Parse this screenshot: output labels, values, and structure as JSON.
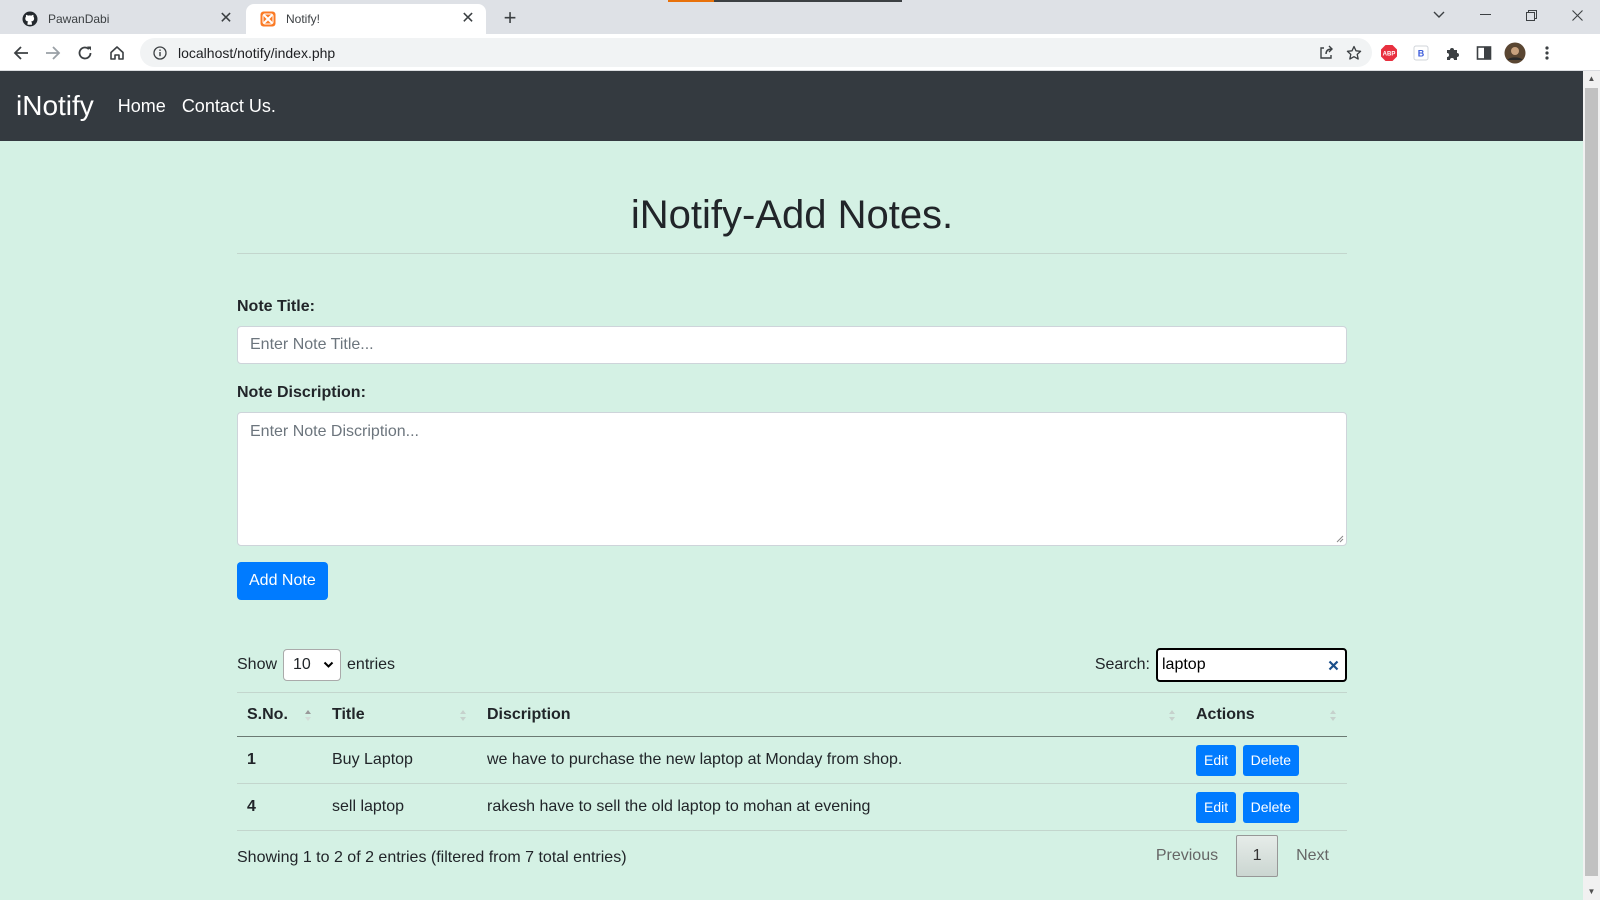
{
  "browser": {
    "tabs": [
      {
        "title": "PawanDabi",
        "icon": "github-icon"
      },
      {
        "title": "Notify!",
        "icon": "xampp-icon"
      }
    ],
    "url": "localhost/notify/index.php",
    "extensions": [
      "adblock-icon",
      "b-extension-icon",
      "puzzle-icon",
      "sidebar-icon",
      "profile-avatar",
      "menu-icon"
    ]
  },
  "navbar": {
    "brand": "iNotify",
    "links": [
      "Home",
      "Contact Us."
    ]
  },
  "form": {
    "heading": "iNotify-Add Notes.",
    "title_label": "Note Title:",
    "title_placeholder": "Enter Note Title...",
    "desc_label": "Note Discription:",
    "desc_placeholder": "Enter Note Discription...",
    "submit_label": "Add Note"
  },
  "table_controls": {
    "show_label": "Show",
    "entries_label": "entries",
    "page_size": "10",
    "search_label": "Search:",
    "search_value": "laptop"
  },
  "table": {
    "columns": [
      "S.No.",
      "Title",
      "Discription",
      "Actions"
    ],
    "rows": [
      {
        "sno": "1",
        "title": "Buy Laptop",
        "desc": "we have to purchase the new laptop at Monday from shop.",
        "edit": "Edit",
        "delete": "Delete"
      },
      {
        "sno": "4",
        "title": "sell laptop",
        "desc": "rakesh have to sell the old laptop to mohan at evening",
        "edit": "Edit",
        "delete": "Delete"
      }
    ]
  },
  "footer": {
    "info": "Showing 1 to 2 of 2 entries (filtered from 7 total entries)",
    "previous": "Previous",
    "current_page": "1",
    "next": "Next"
  },
  "colors": {
    "page_bg": "#d4f1e4",
    "navbar_bg": "#343a40",
    "primary": "#007bff"
  }
}
